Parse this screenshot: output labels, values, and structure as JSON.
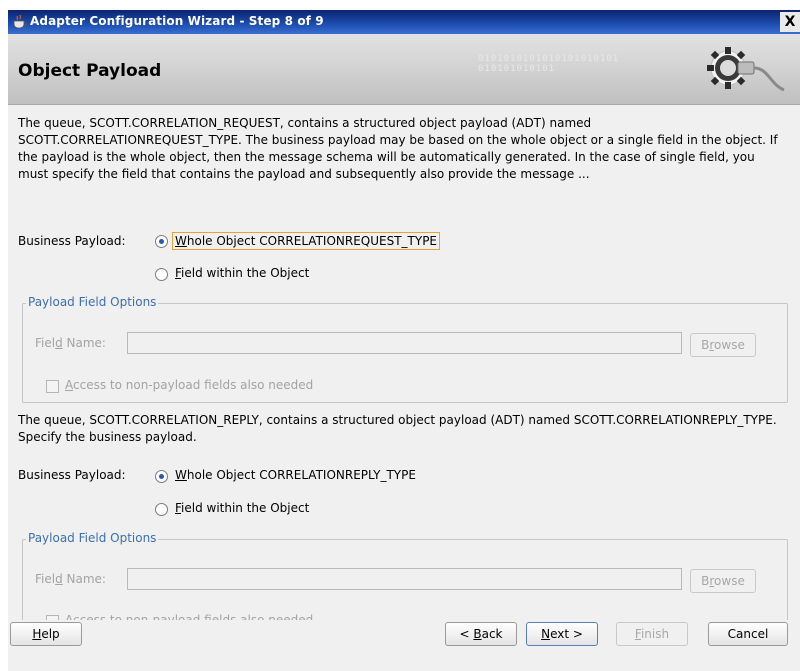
{
  "window": {
    "title": "Adapter Configuration Wizard - Step 8 of 9",
    "close_glyph": "X"
  },
  "banner": {
    "heading": "Object Payload",
    "decoration_text": "0101010101010101010101\n010101010101",
    "icon": "gear-plug-icon"
  },
  "section1": {
    "description": "The queue, SCOTT.CORRELATION_REQUEST, contains a structured object payload (ADT) named SCOTT.CORRELATIONREQUEST_TYPE.  The business payload may be based on the whole object or a single field in the object. If the payload is the whole object, then the message schema will be automatically generated. In the case of single field, you must specify the field that contains the payload and subsequently also provide the message ...",
    "payload_label": "Business Payload:",
    "option_whole": {
      "mnemonic": "W",
      "rest": "hole Object CORRELATIONREQUEST_TYPE",
      "selected": true
    },
    "option_field": {
      "mnemonic": "F",
      "rest": "ield within the Object",
      "selected": false
    },
    "group_title": "Payload Field Options",
    "field_name_label_pre": "Fiel",
    "field_name_label_mn": "d",
    "field_name_label_post": " Name:",
    "field_name_value": "",
    "browse_pre": "B",
    "browse_mn": "r",
    "browse_post": "owse",
    "checkbox_mn": "A",
    "checkbox_rest": "ccess to non-payload fields also needed"
  },
  "section2": {
    "description": "The queue, SCOTT.CORRELATION_REPLY, contains a structured object payload (ADT) named SCOTT.CORRELATIONREPLY_TYPE.  Specify the business payload.",
    "payload_label": "Business Payload:",
    "option_whole": {
      "mnemonic": "W",
      "rest": "hole Object CORRELATIONREPLY_TYPE",
      "selected": true
    },
    "option_field": {
      "mnemonic": "F",
      "rest": "ield within the Object",
      "selected": false
    },
    "group_title": "Payload Field Options",
    "field_name_label_pre": "Fiel",
    "field_name_label_mn": "d",
    "field_name_label_post": " Name:",
    "field_name_value": "",
    "browse_pre": "B",
    "browse_mn": "r",
    "browse_post": "owse",
    "checkbox_mn": "A",
    "checkbox_rest": "ccess to non-payload fields also needed"
  },
  "footer": {
    "help": {
      "mn": "H",
      "rest": "elp"
    },
    "back": {
      "pre": "< ",
      "mn": "B",
      "rest": "ack"
    },
    "next": {
      "mn": "N",
      "rest": "ext >"
    },
    "finish": {
      "mn": "F",
      "rest": "inish"
    },
    "cancel": "Cancel"
  },
  "colors": {
    "titlebar": "#1e4fb0",
    "group_title": "#3c6eb4",
    "focus_border": "#f0a030",
    "disabled_text": "#a3a3a3"
  }
}
